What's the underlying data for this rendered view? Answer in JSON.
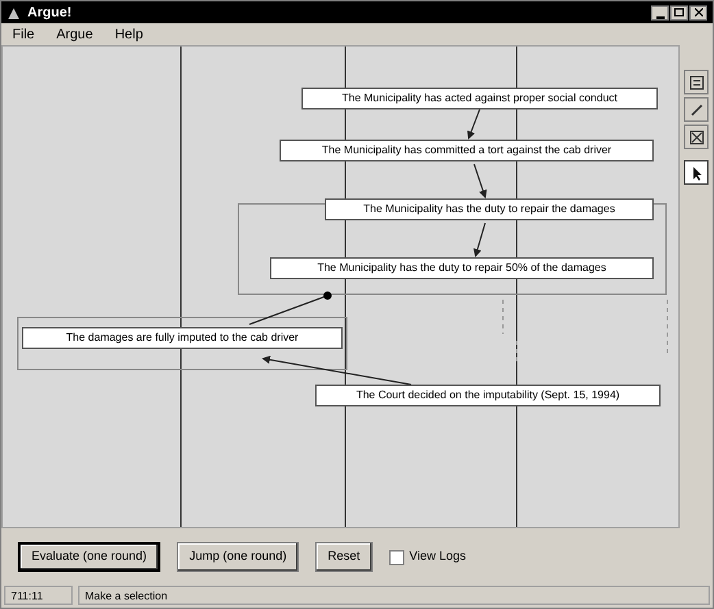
{
  "window": {
    "title": "Argue!"
  },
  "menu": [
    "File",
    "Argue",
    "Help"
  ],
  "statements": [
    {
      "text": "The Municipality has acted against proper social conduct"
    },
    {
      "text": "The Municipality has committed a tort against the cab driver"
    },
    {
      "text": "The Municipality has the duty to repair the damages"
    },
    {
      "text": "The Municipality has the duty to repair 50% of the damages"
    },
    {
      "text": "The damages are fully imputed to the cab driver"
    },
    {
      "text": "The Court decided on the imputability (Sept. 15, 1994)"
    }
  ],
  "tools": [
    {
      "kind": "list",
      "selected": false
    },
    {
      "kind": "pen",
      "selected": false
    },
    {
      "kind": "cross",
      "selected": false
    },
    {
      "kind": "pointer",
      "selected": true
    }
  ],
  "buttons": [
    "Evaluate (one round)",
    "Jump (one round)",
    "Reset"
  ],
  "view_logs": {
    "label": "View Logs",
    "checked": false
  },
  "status_bar": [
    "711:11",
    "Make a selection"
  ]
}
